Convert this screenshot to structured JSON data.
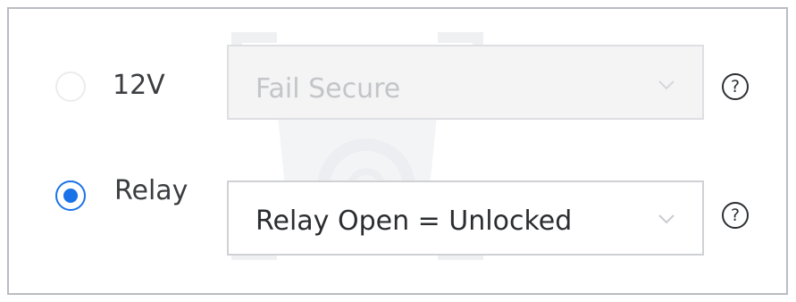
{
  "lock_power": {
    "options": [
      {
        "label": "12V",
        "selected": false,
        "enabled": false,
        "dropdown_value": "Fail Secure"
      },
      {
        "label": "Relay",
        "selected": true,
        "enabled": true,
        "dropdown_value": "Relay Open = Unlocked"
      }
    ],
    "help_glyph": "?"
  },
  "colors": {
    "accent": "#1a72e8",
    "panel_border": "#b9bcc2",
    "disabled_text": "#c3c5c9",
    "text": "#2b2d30"
  },
  "icons": {
    "radio": "radio-icon",
    "chevron": "chevron-down-icon",
    "help": "help-icon"
  }
}
